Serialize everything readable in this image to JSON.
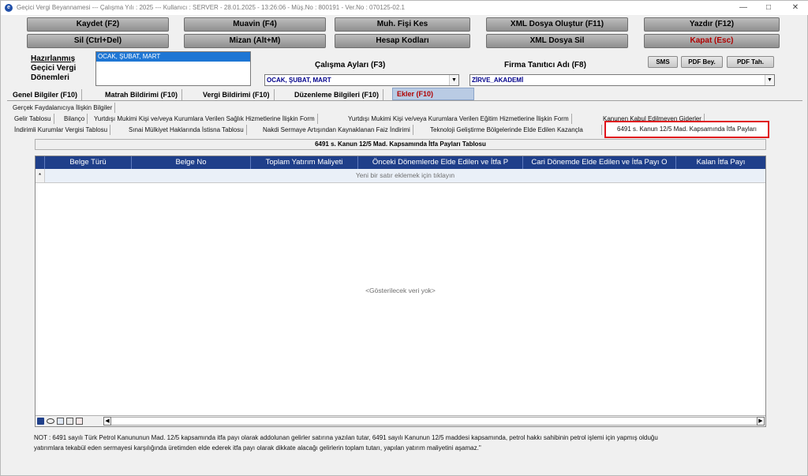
{
  "window": {
    "title": "Geçici Vergi Beyannamesi  ---  Çalışma Yılı : 2025  ---  Kullanıcı : SERVER - 28.01.2025 - 13:26:06 - Müş.No : 800191 - Ver.No : 070125-02.1"
  },
  "toolbar": {
    "kaydet": "Kaydet (F2)",
    "muavin": "Muavin (F4)",
    "muh_fisi": "Muh. Fişi Kes",
    "xml_olustur": "XML Dosya Oluştur (F11)",
    "yazdir": "Yazdır (F12)",
    "sil": "Sil (Ctrl+Del)",
    "mizan": "Mizan (Alt+M)",
    "hesap_kodlari": "Hesap Kodları",
    "xml_sil": "XML Dosya Sil",
    "kapat": "Kapat (Esc)"
  },
  "periods": {
    "label_line1": "Hazırlanmış",
    "label_line2": "Geçici Vergi",
    "label_line3": "Dönemleri",
    "items": [
      "OCAK, ŞUBAT, MART"
    ]
  },
  "calisma": {
    "label": "Çalışma Ayları (F3)",
    "value": "OCAK, ŞUBAT, MART"
  },
  "firma": {
    "label": "Firma Tanıtıcı Adı (F8)",
    "value": "ZİRVE_AKADEMİ"
  },
  "small_buttons": {
    "sms": "SMS",
    "pdf_bey": "PDF Bey.",
    "pdf_tah": "PDF Tah."
  },
  "main_tabs": [
    "Genel Bilgiler (F10)",
    "Matrah Bildirimi (F10)",
    "Vergi Bildirimi (F10)",
    "Düzenleme Bilgileri (F10)",
    "Ekler (F10)"
  ],
  "sub_tabs_row1": [
    "Gerçek Faydalanıcıya İlişkin Bilgiler"
  ],
  "sub_tabs_row2": [
    "Gelir Tablosu",
    "Bilanço",
    "Yurtdışı Mukimi Kişi ve/veya Kurumlara Verilen Sağlık Hizmetlerine İlişkin Form",
    "Yurtdışı Mukimi Kişi ve/veya Kurumlara Verilen Eğitim Hizmetlerine İlişkin Form",
    "Kanunen Kabul Edilmeyen Giderler"
  ],
  "sub_tabs_row3": [
    "İndirimli Kurumlar Vergisi Tablosu",
    "Sınai Mülkiyet Haklarında İstisna Tablosu",
    "Nakdi Sermaye Artışından Kaynaklanan Faiz İndirimi",
    "Teknoloji Geliştirme Bölgelerinde Elde Edilen Kazançla",
    "6491 s. Kanun 12/5 Mad. Kapsamında İtfa Payları"
  ],
  "table": {
    "title": "6491 s. Kanun 12/5 Mad. Kapsamında İtfa Payları Tablosu",
    "columns": [
      "Belge Türü",
      "Belge No",
      "Toplam Yatırım Maliyeti",
      "Önceki Dönemlerde Elde Edilen ve İtfa P",
      "Cari Dönemde Elde Edilen ve İtfa Payı O",
      "Kalan İtfa Payı"
    ],
    "new_row_hint": "Yeni bir satır eklemek için tıklayın",
    "empty_text": "<Gösterilecek veri yok>",
    "row_marker": "*"
  },
  "note": {
    "line1": "NOT : 6491 sayılı Türk Petrol Kanununun Mad. 12/5 kapsamında itfa payı olarak addolunan gelirler satırına yazılan tutar, 6491 sayılı Kanunun 12/5 maddesi kapsamında, petrol hakkı sahibinin petrol işlemi için yapmış olduğu",
    "line2": "yatırımlara tekabül eden sermayesi karşılığında üretimden elde ederek itfa payı olarak dikkate alacağı gelirlerin toplam tutarı, yapılan yatırım maliyetini aşamaz.\""
  },
  "colors": {
    "grid_header": "#1f3f8a",
    "selected_tab": "#b9cbe4",
    "highlight_border": "#e0121b"
  }
}
